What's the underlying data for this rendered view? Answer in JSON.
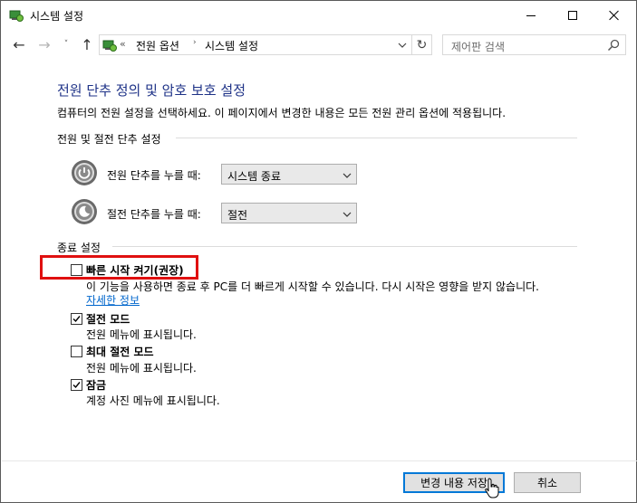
{
  "window": {
    "title": "시스템 설정"
  },
  "nav": {
    "back_label": "←",
    "forward_label": "→",
    "recent_label": "˅",
    "up_label": "↑",
    "address_sep": "«",
    "breadcrumb": [
      "전원 옵션",
      "시스템 설정"
    ],
    "crumb_arrow": "›",
    "refresh_label": "↻",
    "search_placeholder": "제어판 검색"
  },
  "main": {
    "title": "전원 단추 정의 및 암호 보호 설정",
    "description": "컴퓨터의 전원 설정을 선택하세요. 이 페이지에서 변경한 내용은 모든 전원 관리 옵션에 적용됩니다.",
    "power_section": {
      "heading": "전원 및 절전 단추 설정",
      "rows": [
        {
          "label": "전원 단추를 누를 때:",
          "value": "시스템 종료",
          "icon": "power-icon"
        },
        {
          "label": "절전 단추를 누를 때:",
          "value": "절전",
          "icon": "sleep-icon"
        }
      ]
    },
    "shutdown_section": {
      "heading": "종료 설정",
      "options": [
        {
          "label": "빠른 시작 켜기(권장)",
          "checked": false,
          "desc": "이 기능을 사용하면 종료 후 PC를 더 빠르게 시작할 수 있습니다. 다시 시작은 영향을 받지 않습니다.",
          "link": "자세한 정보",
          "highlighted": true
        },
        {
          "label": "절전 모드",
          "checked": true,
          "desc": "전원 메뉴에 표시됩니다."
        },
        {
          "label": "최대 절전 모드",
          "checked": false,
          "desc": "전원 메뉴에 표시됩니다."
        },
        {
          "label": "잠금",
          "checked": true,
          "desc": "계정 사진 메뉴에 표시됩니다."
        }
      ]
    }
  },
  "footer": {
    "save_label": "변경 내용 저장",
    "cancel_label": "취소"
  },
  "colors": {
    "title_blue": "#1e3287",
    "link_blue": "#0066cc",
    "highlight_red": "#e01010",
    "default_button_border": "#0078d7"
  }
}
